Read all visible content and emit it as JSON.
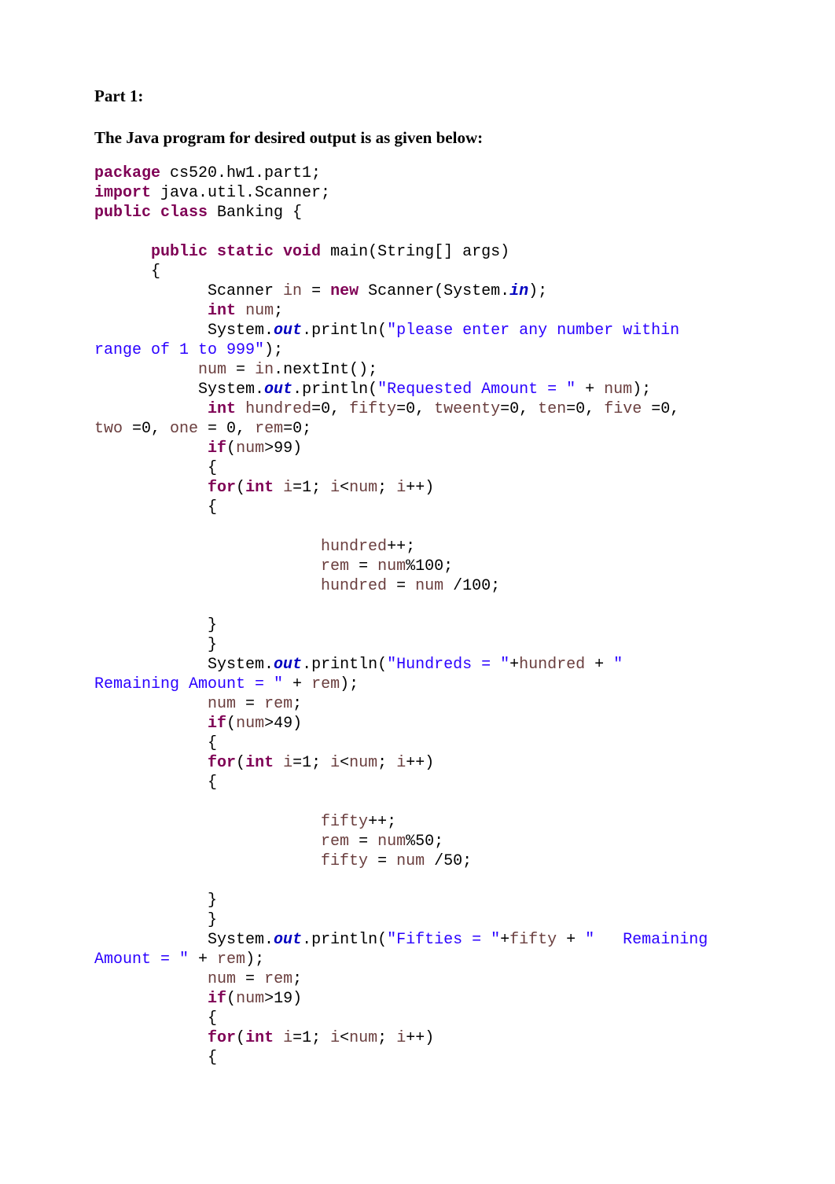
{
  "headings": {
    "part": "Part 1:",
    "sub": "The Java program for desired output is as given below:"
  },
  "code": {
    "l1a": "package",
    "l1b": " cs520.hw1.part1;",
    "l2a": "import",
    "l2b": " java.util.Scanner;",
    "l3a": "public",
    "l3b": " class",
    "l3c": " Banking {",
    "l4": "",
    "l5a": "      ",
    "l5b": "public",
    "l5c": " static",
    "l5d": " void",
    "l5e": " main(String[] args)",
    "l6": "      {",
    "l7a": "            Scanner ",
    "l7b": "in",
    "l7c": " = ",
    "l7d": "new",
    "l7e": " Scanner(System.",
    "l7f": "in",
    "l7g": ");",
    "l8a": "            ",
    "l8b": "int",
    "l8c": " ",
    "l8d": "num",
    "l8e": ";",
    "l9a": "            System.",
    "l9b": "out",
    "l9c": ".println(",
    "l9d": "\"please enter any number within ",
    "l10a": "range of 1 to 999\"",
    "l10b": ");",
    "l11a": "           ",
    "l11b": "num",
    "l11c": " = ",
    "l11d": "in",
    "l11e": ".nextInt();",
    "l12a": "           System.",
    "l12b": "out",
    "l12c": ".println(",
    "l12d": "\"Requested Amount = \"",
    "l12e": " + ",
    "l12f": "num",
    "l12g": ");",
    "l13a": "            ",
    "l13b": "int",
    "l13c": " ",
    "l13d": "hundred",
    "l13e": "=0, ",
    "l13f": "fifty",
    "l13g": "=0, ",
    "l13h": "tweenty",
    "l13i": "=0, ",
    "l13j": "ten",
    "l13k": "=0, ",
    "l13l": "five",
    "l13m": " =0, ",
    "l14a": "two",
    "l14b": " =0, ",
    "l14c": "one",
    "l14d": " = 0, ",
    "l14e": "rem",
    "l14f": "=0;",
    "l15a": "            ",
    "l15b": "if",
    "l15c": "(",
    "l15d": "num",
    "l15e": ">99)",
    "l16": "            {",
    "l17a": "            ",
    "l17b": "for",
    "l17c": "(",
    "l17d": "int",
    "l17e": " ",
    "l17f": "i",
    "l17g": "=1; ",
    "l17h": "i",
    "l17i": "<",
    "l17j": "num",
    "l17k": "; ",
    "l17l": "i",
    "l17m": "++)",
    "l18": "            {",
    "l19": "",
    "l20a": "                        ",
    "l20b": "hundred",
    "l20c": "++;",
    "l21a": "                        ",
    "l21b": "rem",
    "l21c": " = ",
    "l21d": "num",
    "l21e": "%100;",
    "l22a": "                        ",
    "l22b": "hundred",
    "l22c": " = ",
    "l22d": "num",
    "l22e": " /100;",
    "l23": "",
    "l24": "            }",
    "l25": "            }",
    "l26a": "            System.",
    "l26b": "out",
    "l26c": ".println(",
    "l26d": "\"Hundreds = \"",
    "l26e": "+",
    "l26f": "hundred",
    "l26g": " + ",
    "l26h": "\"  ",
    "l27a": "Remaining Amount = \"",
    "l27b": " + ",
    "l27c": "rem",
    "l27d": ");",
    "l28a": "            ",
    "l28b": "num",
    "l28c": " = ",
    "l28d": "rem",
    "l28e": ";",
    "l29a": "            ",
    "l29b": "if",
    "l29c": "(",
    "l29d": "num",
    "l29e": ">49)",
    "l30": "            {",
    "l31a": "            ",
    "l31b": "for",
    "l31c": "(",
    "l31d": "int",
    "l31e": " ",
    "l31f": "i",
    "l31g": "=1; ",
    "l31h": "i",
    "l31i": "<",
    "l31j": "num",
    "l31k": "; ",
    "l31l": "i",
    "l31m": "++)",
    "l32": "            {",
    "l33": "",
    "l34a": "                        ",
    "l34b": "fifty",
    "l34c": "++;",
    "l35a": "                        ",
    "l35b": "rem",
    "l35c": " = ",
    "l35d": "num",
    "l35e": "%50;",
    "l36a": "                        ",
    "l36b": "fifty",
    "l36c": " = ",
    "l36d": "num",
    "l36e": " /50;",
    "l37": "",
    "l38": "            }",
    "l39": "            }",
    "l40a": "            System.",
    "l40b": "out",
    "l40c": ".println(",
    "l40d": "\"Fifties = \"",
    "l40e": "+",
    "l40f": "fifty",
    "l40g": " + ",
    "l40h": "\"   Remaining ",
    "l41a": "Amount = \"",
    "l41b": " + ",
    "l41c": "rem",
    "l41d": ");",
    "l42a": "            ",
    "l42b": "num",
    "l42c": " = ",
    "l42d": "rem",
    "l42e": ";",
    "l43a": "            ",
    "l43b": "if",
    "l43c": "(",
    "l43d": "num",
    "l43e": ">19)",
    "l44": "            {",
    "l45a": "            ",
    "l45b": "for",
    "l45c": "(",
    "l45d": "int",
    "l45e": " ",
    "l45f": "i",
    "l45g": "=1; ",
    "l45h": "i",
    "l45i": "<",
    "l45j": "num",
    "l45k": "; ",
    "l45l": "i",
    "l45m": "++)",
    "l46": "            {"
  }
}
